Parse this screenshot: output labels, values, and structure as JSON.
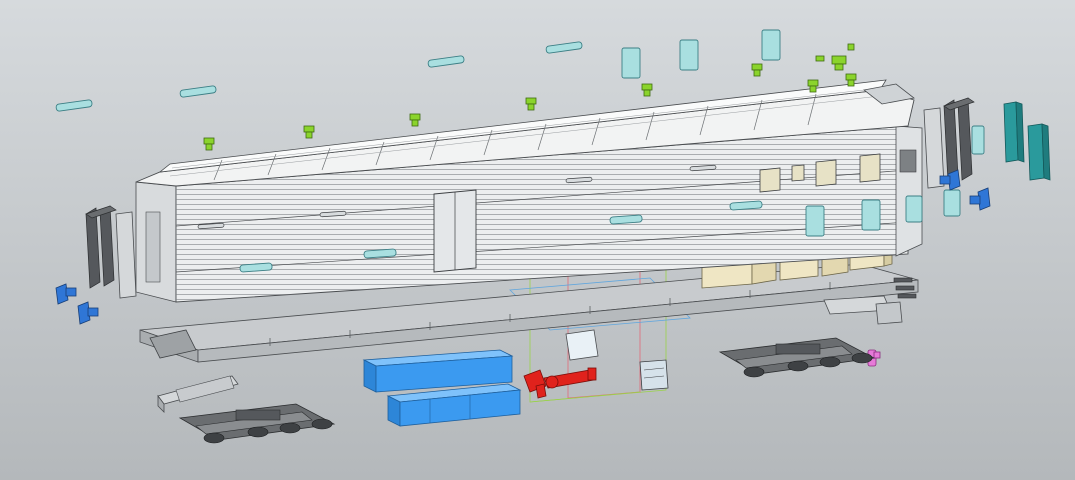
{
  "viewport": {
    "background_top": "#d6dadd",
    "background_bottom": "#b4b8bb"
  },
  "colors": {
    "body_metal": "#eceeef",
    "body_line": "#4a4d50",
    "roof": "#f2f3f3",
    "glass": "#a9dfe0",
    "glass_edge": "#3c7f85",
    "clip_green": "#8bd42c",
    "steps_dark": "#55585c",
    "coupler_blue": "#2f76d6",
    "battery_blue": "#3b9af0",
    "brake_red": "#e0221c",
    "teal_door": "#2a9a9c",
    "interior_cream": "#efe6c4",
    "pink_part": "#e67ad8",
    "underframe": "#c8cbce",
    "truck_dark": "#6a6d70",
    "box_light": "#e9f1f6",
    "wire_green": "#9ad24a",
    "wire_red": "#e26a78",
    "wire_blue": "#5fa6de"
  },
  "parts": [
    "car-body",
    "roof",
    "underframe",
    "front-truck",
    "rear-truck",
    "battery-box-upper",
    "battery-box-lower",
    "brake-cylinder",
    "water-tank",
    "equipment-box",
    "end-steps-left",
    "end-steps-right",
    "coupler-left",
    "coupler-right",
    "window-glazing",
    "mounting-clips",
    "vestibule-doors",
    "interior-partitions",
    "marker-light"
  ]
}
